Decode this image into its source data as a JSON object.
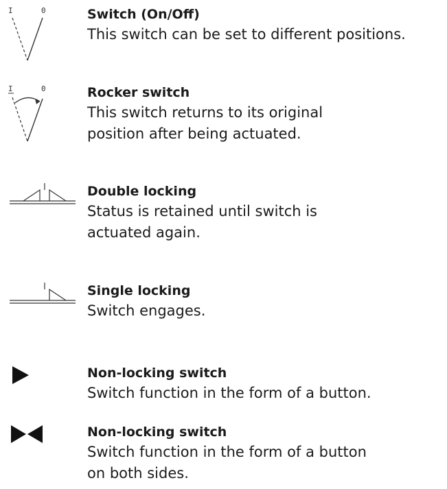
{
  "entries": [
    {
      "symbol": "on-off-switch-icon",
      "symbol_labels": [
        "I",
        "0"
      ],
      "title": "Switch (On/Off)",
      "description": [
        "This switch can be set to different positions."
      ]
    },
    {
      "symbol": "rocker-switch-icon",
      "symbol_labels": [
        "I",
        "0"
      ],
      "title": "Rocker switch",
      "description": [
        "This switch returns to its original",
        "position after being actuated."
      ]
    },
    {
      "symbol": "double-locking-icon",
      "title": "Double locking",
      "description": [
        "Status is retained until switch is",
        "actuated again."
      ]
    },
    {
      "symbol": "single-locking-icon",
      "title": "Single locking",
      "description": [
        "Switch engages."
      ]
    },
    {
      "symbol": "play-triangle-icon",
      "title": "Non-locking switch",
      "description": [
        "Switch function in the form of a button."
      ]
    },
    {
      "symbol": "bowtie-icon",
      "title": "Non-locking switch",
      "description": [
        "Switch function in the form of a button",
        "on both sides."
      ]
    }
  ]
}
